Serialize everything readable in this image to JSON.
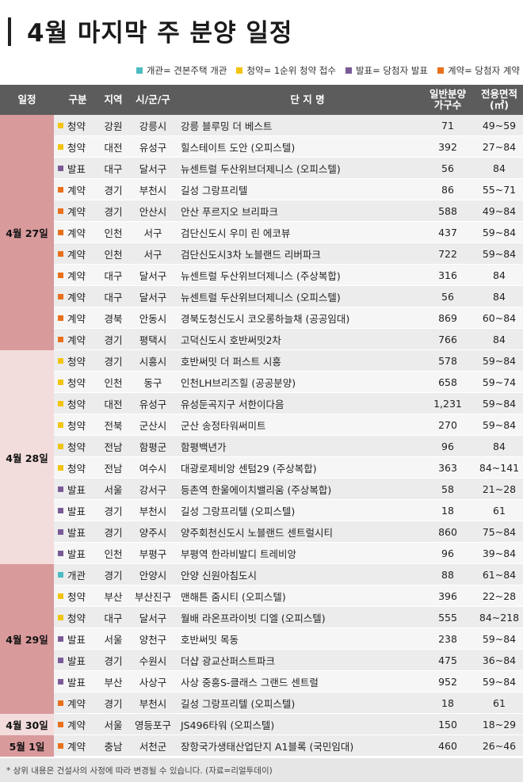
{
  "title": "4월 마지막 주 분양 일정",
  "colors": {
    "open": "#4cbcc2",
    "subscribe": "#f2c411",
    "announce": "#7a5a96",
    "contract": "#e8701c",
    "row_bg": "#ececec",
    "row_bg_alt": "#f6f6f6"
  },
  "legend": [
    {
      "key": "open",
      "label": "개관= 견본주택 개관"
    },
    {
      "key": "subscribe",
      "label": "청약= 1순위 청약 접수"
    },
    {
      "key": "announce",
      "label": "발표= 당첨자 발표"
    },
    {
      "key": "contract",
      "label": "계약= 당첨자 계약"
    }
  ],
  "headers": {
    "date": "일정",
    "type": "구분",
    "region": "지역",
    "city": "시/군/구",
    "name": "단 지 명",
    "units": "일반분양\n가구수",
    "area": "전용면적\n(㎡)"
  },
  "groups": [
    {
      "date": "4월 27일",
      "date_bg": "#d99a9c",
      "rows": [
        {
          "kind": "subscribe",
          "type": "청약",
          "region": "강원",
          "city": "강릉시",
          "name": "강릉 블루밍 더 베스트",
          "units": "71",
          "area": "49~59"
        },
        {
          "kind": "subscribe",
          "type": "청약",
          "region": "대전",
          "city": "유성구",
          "name": "힐스테이트 도안 (오피스텔)",
          "units": "392",
          "area": "27~84"
        },
        {
          "kind": "announce",
          "type": "발표",
          "region": "대구",
          "city": "달서구",
          "name": "뉴센트럴 두산위브더제니스 (오피스텔)",
          "units": "56",
          "area": "84"
        },
        {
          "kind": "contract",
          "type": "계약",
          "region": "경기",
          "city": "부천시",
          "name": "길성 그랑프리텔",
          "units": "86",
          "area": "55~71"
        },
        {
          "kind": "contract",
          "type": "계약",
          "region": "경기",
          "city": "안산시",
          "name": "안산 푸르지오 브리파크",
          "units": "588",
          "area": "49~84"
        },
        {
          "kind": "contract",
          "type": "계약",
          "region": "인천",
          "city": "서구",
          "name": "검단신도시 우미 린 에코뷰",
          "units": "437",
          "area": "59~84"
        },
        {
          "kind": "contract",
          "type": "계약",
          "region": "인천",
          "city": "서구",
          "name": "검단신도시3차 노블랜드 리버파크",
          "units": "722",
          "area": "59~84"
        },
        {
          "kind": "contract",
          "type": "계약",
          "region": "대구",
          "city": "달서구",
          "name": "뉴센트럴 두산위브더제니스 (주상복합)",
          "units": "316",
          "area": "84"
        },
        {
          "kind": "contract",
          "type": "계약",
          "region": "대구",
          "city": "달서구",
          "name": "뉴센트럴 두산위브더제니스 (오피스텔)",
          "units": "56",
          "area": "84"
        },
        {
          "kind": "contract",
          "type": "계약",
          "region": "경북",
          "city": "안동시",
          "name": "경북도청신도시 코오롱하늘채 (공공임대)",
          "units": "869",
          "area": "60~84"
        },
        {
          "kind": "contract",
          "type": "계약",
          "region": "경기",
          "city": "평택시",
          "name": "고덕신도시 호반써밋2차",
          "units": "766",
          "area": "84"
        }
      ]
    },
    {
      "date": "4월 28일",
      "date_bg": "#f3dcdc",
      "rows": [
        {
          "kind": "subscribe",
          "type": "청약",
          "region": "경기",
          "city": "시흥시",
          "name": "호반써밋 더 퍼스트 시흥",
          "units": "578",
          "area": "59~84"
        },
        {
          "kind": "subscribe",
          "type": "청약",
          "region": "인천",
          "city": "동구",
          "name": "인천LH브리즈힐 (공공분양)",
          "units": "658",
          "area": "59~74"
        },
        {
          "kind": "subscribe",
          "type": "청약",
          "region": "대전",
          "city": "유성구",
          "name": "유성둔곡지구 서한이다음",
          "units": "1,231",
          "area": "59~84"
        },
        {
          "kind": "subscribe",
          "type": "청약",
          "region": "전북",
          "city": "군산시",
          "name": "군산 송정타워써미트",
          "units": "270",
          "area": "59~84"
        },
        {
          "kind": "subscribe",
          "type": "청약",
          "region": "전남",
          "city": "함평군",
          "name": "함평백년가",
          "units": "96",
          "area": "84"
        },
        {
          "kind": "subscribe",
          "type": "청약",
          "region": "전남",
          "city": "여수시",
          "name": "대광로제비앙 센텀29 (주상복합)",
          "units": "363",
          "area": "84~141"
        },
        {
          "kind": "announce",
          "type": "발표",
          "region": "서울",
          "city": "강서구",
          "name": "등촌역 한울에이치밸리움 (주상복합)",
          "units": "58",
          "area": "21~28"
        },
        {
          "kind": "announce",
          "type": "발표",
          "region": "경기",
          "city": "부천시",
          "name": "길성 그랑프리텔 (오피스텔)",
          "units": "18",
          "area": "61"
        },
        {
          "kind": "announce",
          "type": "발표",
          "region": "경기",
          "city": "양주시",
          "name": "양주회천신도시 노블랜드 센트럴시티",
          "units": "860",
          "area": "75~84"
        },
        {
          "kind": "announce",
          "type": "발표",
          "region": "인천",
          "city": "부평구",
          "name": "부평역 한라비발디 트레비앙",
          "units": "96",
          "area": "39~84"
        }
      ]
    },
    {
      "date": "4월 29일",
      "date_bg": "#d99a9c",
      "rows": [
        {
          "kind": "open",
          "type": "개관",
          "region": "경기",
          "city": "안양시",
          "name": "안양 신원아침도시",
          "units": "88",
          "area": "61~84"
        },
        {
          "kind": "subscribe",
          "type": "청약",
          "region": "부산",
          "city": "부산진구",
          "name": "맨해튼 줌시티 (오피스텔)",
          "units": "396",
          "area": "22~28"
        },
        {
          "kind": "subscribe",
          "type": "청약",
          "region": "대구",
          "city": "달서구",
          "name": "월배 라온프라이빗 디엘 (오피스텔)",
          "units": "555",
          "area": "84~218"
        },
        {
          "kind": "announce",
          "type": "발표",
          "region": "서울",
          "city": "양천구",
          "name": "호반써밋 목동",
          "units": "238",
          "area": "59~84"
        },
        {
          "kind": "announce",
          "type": "발표",
          "region": "경기",
          "city": "수원시",
          "name": "더샵 광교산퍼스트파크",
          "units": "475",
          "area": "36~84"
        },
        {
          "kind": "announce",
          "type": "발표",
          "region": "부산",
          "city": "사상구",
          "name": "사상 중흥S-클래스 그랜드 센트럴",
          "units": "952",
          "area": "59~84"
        },
        {
          "kind": "contract",
          "type": "계약",
          "region": "경기",
          "city": "부천시",
          "name": "길성 그랑프리텔 (오피스텔)",
          "units": "18",
          "area": "61"
        }
      ]
    },
    {
      "date": "4월 30일",
      "date_bg": "#f3dcdc",
      "rows": [
        {
          "kind": "contract",
          "type": "계약",
          "region": "서울",
          "city": "영등포구",
          "name": "JS496타워 (오피스텔)",
          "units": "150",
          "area": "18~29"
        }
      ]
    },
    {
      "date": "5월 1일",
      "date_bg": "#d99a9c",
      "rows": [
        {
          "kind": "contract",
          "type": "계약",
          "region": "충남",
          "city": "서천군",
          "name": "장항국가생태산업단지 A1블록 (국민임대)",
          "units": "460",
          "area": "26~46"
        }
      ]
    }
  ],
  "footer": "* 상위 내용은 건설사의 사정에 따라 변경될 수 있습니다. (자료=리얼투데이)"
}
